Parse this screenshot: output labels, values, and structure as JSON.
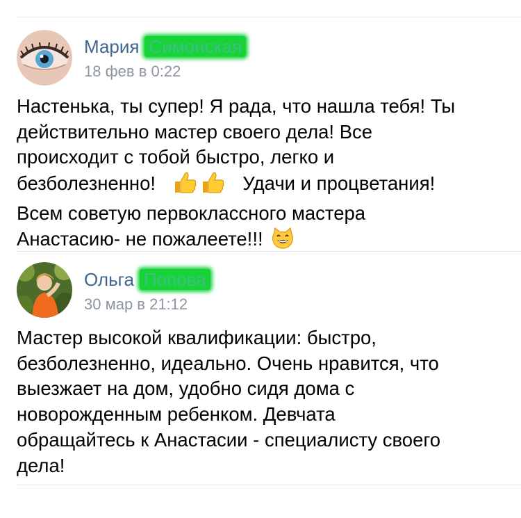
{
  "posts": [
    {
      "first_name": "Мария",
      "surname_redacted": "Симонская",
      "date": "18 фев в 0:22",
      "lines": [
        "Настенька, ты супер! Я рада, что нашла тебя! Ты",
        "действительно мастер своего дела! Все",
        "происходит с тобой быстро, легко и"
      ],
      "line4_start": "безболезненно!",
      "line4_end": "Удачи и процветания!",
      "line5": "Всем советую первоклассного мастера",
      "line6": "Анастасию- не пожалеете!!!"
    },
    {
      "first_name": "Ольга",
      "surname_redacted": "Попова",
      "date": "30 мар в 21:12",
      "lines": [
        "Мастер высокой квалификации: быстро,",
        "безболезненно, идеально. Очень нравится, что",
        "выезжает на дом, удобно сидя дома с",
        "новорожденным ребенком. Девчата",
        "обращайтесь к Анастасии - специалисту своего",
        "дела!"
      ]
    }
  ],
  "icons": {
    "thumbs_up": "thumbs-up-icon",
    "smiling_cat": "smiling-cat-icon"
  },
  "colors": {
    "name": "#3f6591",
    "date": "#8e95a0",
    "redaction": "#18d337",
    "divider": "#e4e6ea"
  }
}
